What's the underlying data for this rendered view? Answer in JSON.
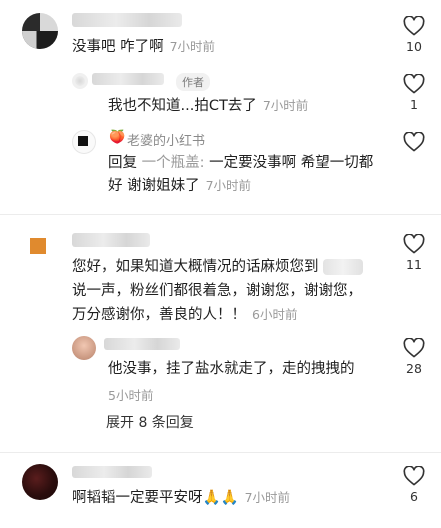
{
  "comments": [
    {
      "text": "没事吧 咋了啊",
      "time": "7小时前",
      "likes": "10",
      "replies": [
        {
          "text": "我也不知道...拍CT去了",
          "time": "7小时前",
          "likes": "1",
          "author_tag": "作者"
        },
        {
          "name": "老婆的小红书",
          "reply_prefix": "回复",
          "reply_target": "一个瓶盖:",
          "text_line1": "一定要没事啊 希望一切都",
          "text_line2": "好 谢谢姐妹了",
          "time": "7小时前"
        }
      ]
    },
    {
      "line1": "您好，如果知道大概情况的话麻烦您到",
      "line2": "说一声，粉丝们都很着急，谢谢您，谢谢您，",
      "line3": "万分感谢你，善良的人！！",
      "time": "6小时前",
      "likes": "11",
      "replies": [
        {
          "text": "他没事，挂了盐水就走了，走的拽拽的",
          "time": "5小时前",
          "likes": "28"
        }
      ],
      "expand_label": "展开 8 条回复"
    },
    {
      "text": "啊韬韬一定要平安呀🙏🙏",
      "time": "7小时前",
      "likes": "6"
    }
  ],
  "colors": {
    "text": "#1f1f1f",
    "muted": "#9a9a9a",
    "accent_orange": "#e08a2e"
  }
}
